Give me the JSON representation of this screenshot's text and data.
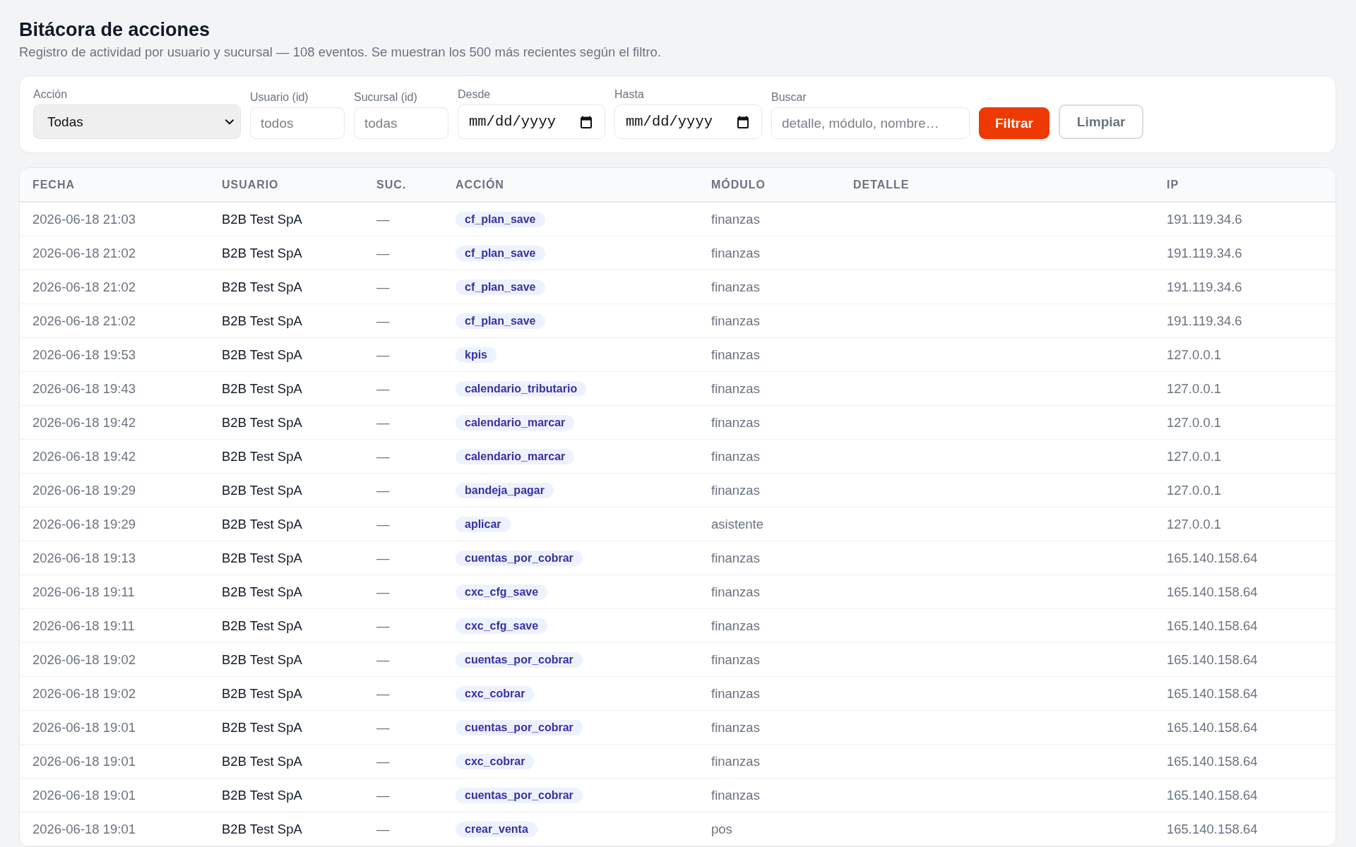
{
  "page": {
    "title": "Bitácora de acciones",
    "subtitle": "Registro de actividad por usuario y sucursal — 108 eventos. Se muestran los 500 más recientes según el filtro."
  },
  "filters": [
    {
      "kind": "select",
      "label": "Acción",
      "value": "Todas"
    },
    {
      "kind": "text",
      "label": "Usuario (id)",
      "placeholder": "todos"
    },
    {
      "kind": "text",
      "label": "Sucursal (id)",
      "placeholder": "todas"
    },
    {
      "kind": "date",
      "label": "Desde",
      "placeholder": "mm/dd/yyyy"
    },
    {
      "kind": "date",
      "label": "Hasta",
      "placeholder": "mm/dd/yyyy"
    },
    {
      "kind": "search",
      "label": "Buscar",
      "placeholder": "detalle, módulo, nombre…"
    }
  ],
  "buttons": [
    {
      "kind": "primary",
      "label": "Filtrar"
    },
    {
      "kind": "secondary",
      "label": "Limpiar"
    }
  ],
  "table": {
    "columns": [
      "FECHA",
      "USUARIO",
      "SUC.",
      "ACCIÓN",
      "MÓDULO",
      "DETALLE",
      "IP"
    ],
    "rows": [
      {
        "fecha": "2026-06-18 21:03",
        "usuario": "B2B Test SpA",
        "sucursal": "—",
        "accion": "cf_plan_save",
        "modulo": "finanzas",
        "ip": "191.119.34.6"
      },
      {
        "fecha": "2026-06-18 21:02",
        "usuario": "B2B Test SpA",
        "sucursal": "—",
        "accion": "cf_plan_save",
        "modulo": "finanzas",
        "ip": "191.119.34.6"
      },
      {
        "fecha": "2026-06-18 21:02",
        "usuario": "B2B Test SpA",
        "sucursal": "—",
        "accion": "cf_plan_save",
        "modulo": "finanzas",
        "ip": "191.119.34.6"
      },
      {
        "fecha": "2026-06-18 21:02",
        "usuario": "B2B Test SpA",
        "sucursal": "—",
        "accion": "cf_plan_save",
        "modulo": "finanzas",
        "ip": "191.119.34.6"
      },
      {
        "fecha": "2026-06-18 19:53",
        "usuario": "B2B Test SpA",
        "sucursal": "—",
        "accion": "kpis",
        "modulo": "finanzas",
        "ip": "127.0.0.1"
      },
      {
        "fecha": "2026-06-18 19:43",
        "usuario": "B2B Test SpA",
        "sucursal": "—",
        "accion": "calendario_tributario",
        "modulo": "finanzas",
        "ip": "127.0.0.1"
      },
      {
        "fecha": "2026-06-18 19:42",
        "usuario": "B2B Test SpA",
        "sucursal": "—",
        "accion": "calendario_marcar",
        "modulo": "finanzas",
        "ip": "127.0.0.1"
      },
      {
        "fecha": "2026-06-18 19:42",
        "usuario": "B2B Test SpA",
        "sucursal": "—",
        "accion": "calendario_marcar",
        "modulo": "finanzas",
        "ip": "127.0.0.1"
      },
      {
        "fecha": "2026-06-18 19:29",
        "usuario": "B2B Test SpA",
        "sucursal": "—",
        "accion": "bandeja_pagar",
        "modulo": "finanzas",
        "ip": "127.0.0.1"
      },
      {
        "fecha": "2026-06-18 19:29",
        "usuario": "B2B Test SpA",
        "sucursal": "—",
        "accion": "aplicar",
        "modulo": "asistente",
        "ip": "127.0.0.1"
      },
      {
        "fecha": "2026-06-18 19:13",
        "usuario": "B2B Test SpA",
        "sucursal": "—",
        "accion": "cuentas_por_cobrar",
        "modulo": "finanzas",
        "ip": "165.140.158.64"
      },
      {
        "fecha": "2026-06-18 19:11",
        "usuario": "B2B Test SpA",
        "sucursal": "—",
        "accion": "cxc_cfg_save",
        "modulo": "finanzas",
        "ip": "165.140.158.64"
      },
      {
        "fecha": "2026-06-18 19:11",
        "usuario": "B2B Test SpA",
        "sucursal": "—",
        "accion": "cxc_cfg_save",
        "modulo": "finanzas",
        "ip": "165.140.158.64"
      },
      {
        "fecha": "2026-06-18 19:02",
        "usuario": "B2B Test SpA",
        "sucursal": "—",
        "accion": "cuentas_por_cobrar",
        "modulo": "finanzas",
        "ip": "165.140.158.64"
      },
      {
        "fecha": "2026-06-18 19:02",
        "usuario": "B2B Test SpA",
        "sucursal": "—",
        "accion": "cxc_cobrar",
        "modulo": "finanzas",
        "ip": "165.140.158.64"
      },
      {
        "fecha": "2026-06-18 19:01",
        "usuario": "B2B Test SpA",
        "sucursal": "—",
        "accion": "cuentas_por_cobrar",
        "modulo": "finanzas",
        "ip": "165.140.158.64"
      },
      {
        "fecha": "2026-06-18 19:01",
        "usuario": "B2B Test SpA",
        "sucursal": "—",
        "accion": "cxc_cobrar",
        "modulo": "finanzas",
        "ip": "165.140.158.64"
      },
      {
        "fecha": "2026-06-18 19:01",
        "usuario": "B2B Test SpA",
        "sucursal": "—",
        "accion": "cuentas_por_cobrar",
        "modulo": "finanzas",
        "ip": "165.140.158.64"
      },
      {
        "fecha": "2026-06-18 19:01",
        "usuario": "B2B Test SpA",
        "sucursal": "—",
        "accion": "crear_venta",
        "modulo": "pos",
        "ip": "165.140.158.64"
      }
    ]
  }
}
